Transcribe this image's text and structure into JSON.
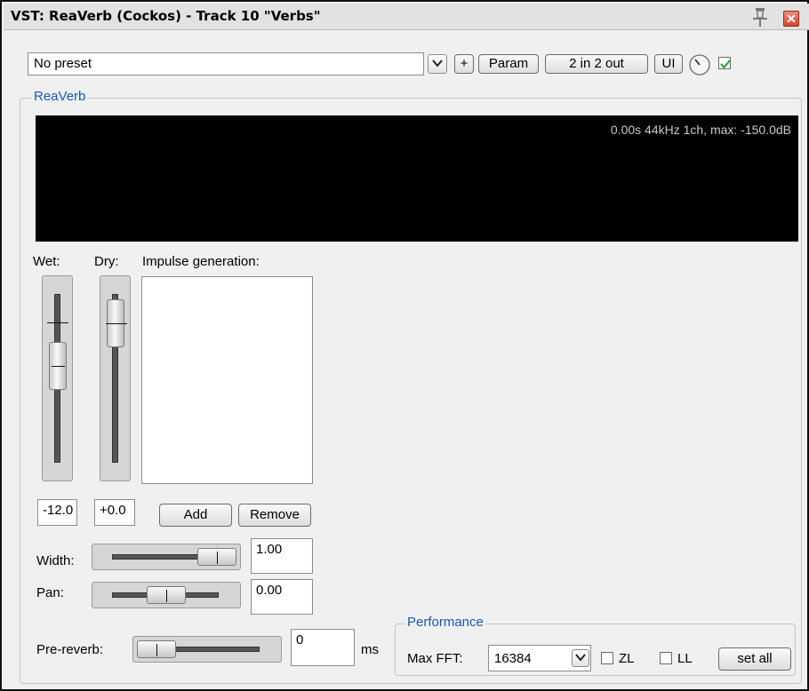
{
  "window": {
    "title": "VST: ReaVerb (Cockos) - Track 10 \"Verbs\""
  },
  "toolbar": {
    "preset_value": "No preset",
    "plus_label": "+",
    "param_label": "Param",
    "io_label": "2 in 2 out",
    "ui_label": "UI",
    "enabled": true
  },
  "reaverb": {
    "group_label": "ReaVerb",
    "display_text": "0.00s 44kHz 1ch, max: -150.0dB",
    "wet_label": "Wet:",
    "dry_label": "Dry:",
    "impulse_label": "Impulse generation:",
    "wet_value": "-12.0",
    "dry_value": "+0.0",
    "add_label": "Add",
    "remove_label": "Remove",
    "width_label": "Width:",
    "width_value": "1.00",
    "pan_label": "Pan:",
    "pan_value": "0.00",
    "prereverb_label": "Pre-reverb:",
    "prereverb_value": "0",
    "prereverb_unit": "ms"
  },
  "performance": {
    "group_label": "Performance",
    "maxfft_label": "Max FFT:",
    "maxfft_value": "16384",
    "zl_label": "ZL",
    "zl_checked": false,
    "ll_label": "LL",
    "ll_checked": false,
    "setall_label": "set all"
  },
  "colors": {
    "group_label": "#1a55c4",
    "display_bg": "#000000",
    "close_button": "#d6432e",
    "checkbox_check": "#1e9e2c"
  }
}
